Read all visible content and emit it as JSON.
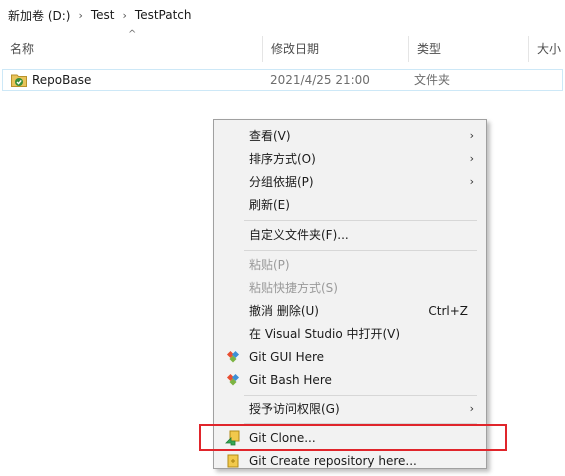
{
  "breadcrumb": {
    "items": [
      "新加卷 (D:)",
      "Test",
      "TestPatch"
    ],
    "separator": "›"
  },
  "columns": {
    "name": "名称",
    "date": "修改日期",
    "type": "类型",
    "size": "大小"
  },
  "files": [
    {
      "name": "RepoBase",
      "date": "2021/4/25 21:00",
      "type": "文件夹",
      "icon": "git-folder-icon"
    }
  ],
  "menu": {
    "items": [
      {
        "label": "查看(V)",
        "submenu": true
      },
      {
        "label": "排序方式(O)",
        "submenu": true
      },
      {
        "label": "分组依据(P)",
        "submenu": true
      },
      {
        "label": "刷新(E)"
      },
      {
        "label": "自定义文件夹(F)..."
      },
      {
        "label": "粘贴(P)",
        "disabled": true
      },
      {
        "label": "粘贴快捷方式(S)",
        "disabled": true
      },
      {
        "label": "撤消 删除(U)",
        "shortcut": "Ctrl+Z"
      },
      {
        "label": "在 Visual Studio 中打开(V)"
      },
      {
        "label": "Git GUI Here",
        "icon": "git-diamond-icon"
      },
      {
        "label": "Git Bash Here",
        "icon": "git-diamond-icon"
      },
      {
        "label": "授予访问权限(G)",
        "submenu": true
      },
      {
        "label": "Git Clone...",
        "icon": "git-clone-icon"
      },
      {
        "label": "Git Create repository here...",
        "icon": "git-create-icon"
      }
    ],
    "submenu_arrow": "›"
  },
  "colors": {
    "highlight_border": "#e0252b",
    "row_border": "#cde8f7",
    "menu_bg": "#f2f2f2",
    "disabled_text": "#9a9a9a"
  }
}
